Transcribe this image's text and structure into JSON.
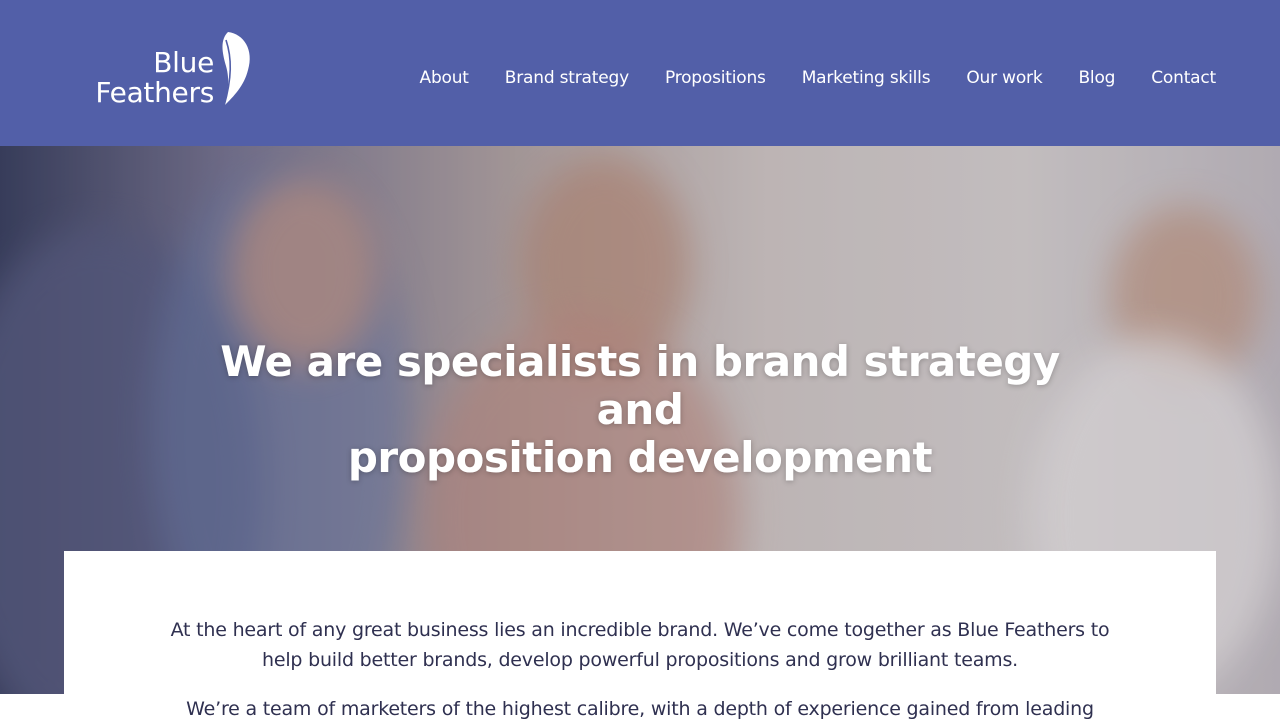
{
  "brand": {
    "logo_line1": "Blue",
    "logo_line2": "Feathers",
    "header_color": "#525fa8"
  },
  "nav": {
    "items": [
      {
        "label": "About"
      },
      {
        "label": "Brand strategy"
      },
      {
        "label": "Propositions"
      },
      {
        "label": "Marketing skills"
      },
      {
        "label": "Our work"
      },
      {
        "label": "Blog"
      },
      {
        "label": "Contact"
      }
    ]
  },
  "hero": {
    "title_line1": "We are specialists in brand strategy",
    "title_line2": "and",
    "title_line3": "proposition development",
    "image": "team-meeting-photo"
  },
  "intro": {
    "paragraph1": "At the heart of any great business lies an incredible brand. We’ve come together as Blue Feathers to help build better brands, develop powerful propositions and grow brilliant teams.",
    "paragraph2": "We’re a team of marketers of the highest calibre, with a depth of experience gained from leading"
  }
}
